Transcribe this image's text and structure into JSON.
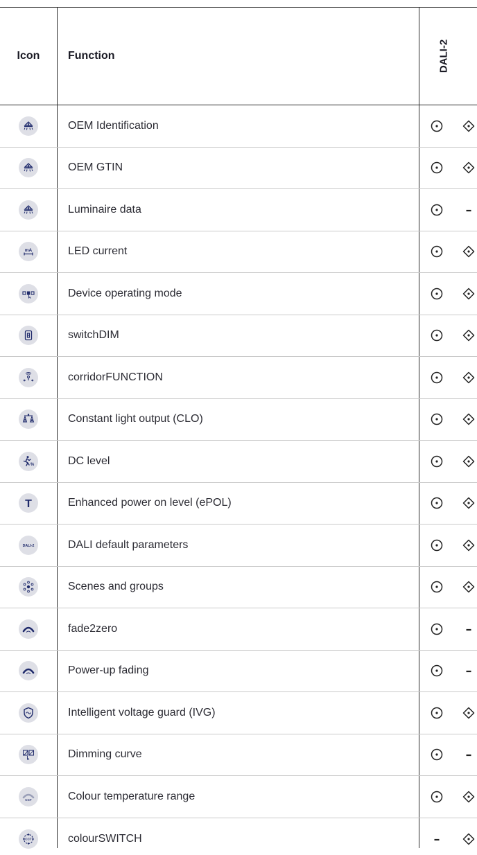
{
  "header": {
    "icon_label": "Icon",
    "function_label": "Function",
    "dali_label": "DALI-2"
  },
  "rows": [
    {
      "icon": "luminaire-info-icon",
      "function": "OEM Identification",
      "col1": "circle-dot",
      "col2": "diamond-dot"
    },
    {
      "icon": "luminaire-info-icon",
      "function": "OEM GTIN",
      "col1": "circle-dot",
      "col2": "diamond-dot"
    },
    {
      "icon": "luminaire-info-icon",
      "function": "Luminaire data",
      "col1": "circle-dot",
      "col2": "dash"
    },
    {
      "icon": "led-current-icon",
      "function": "LED current",
      "col1": "circle-dot",
      "col2": "diamond-dot"
    },
    {
      "icon": "operating-mode-icon",
      "function": "Device operating mode",
      "col1": "circle-dot",
      "col2": "diamond-dot"
    },
    {
      "icon": "switch-icon",
      "function": "switchDIM",
      "col1": "circle-dot",
      "col2": "diamond-dot"
    },
    {
      "icon": "corridor-sensor-icon",
      "function": "corridorFUNCTION",
      "col1": "circle-dot",
      "col2": "diamond-dot"
    },
    {
      "icon": "constant-light-icon",
      "function": "Constant light output (CLO)",
      "col1": "circle-dot",
      "col2": "diamond-dot"
    },
    {
      "icon": "dc-level-icon",
      "function": "DC level",
      "col1": "circle-dot",
      "col2": "diamond-dot"
    },
    {
      "icon": "power-on-level-icon",
      "function": "Enhanced power on level (ePOL)",
      "col1": "circle-dot",
      "col2": "diamond-dot"
    },
    {
      "icon": "dali-defaults-icon",
      "function": "DALI default parameters",
      "col1": "circle-dot",
      "col2": "diamond-dot"
    },
    {
      "icon": "scenes-groups-icon",
      "function": "Scenes and groups",
      "col1": "circle-dot",
      "col2": "diamond-dot"
    },
    {
      "icon": "fade-arc-icon",
      "function": "fade2zero",
      "col1": "circle-dot",
      "col2": "dash"
    },
    {
      "icon": "fade-arc-icon",
      "function": "Power-up fading",
      "col1": "circle-dot",
      "col2": "dash"
    },
    {
      "icon": "voltage-guard-icon",
      "function": "Intelligent voltage guard (IVG)",
      "col1": "circle-dot",
      "col2": "diamond-dot"
    },
    {
      "icon": "dimming-curve-icon",
      "function": "Dimming curve",
      "col1": "circle-dot",
      "col2": "dash"
    },
    {
      "icon": "cct-range-icon",
      "function": "Colour temperature range",
      "col1": "circle-dot",
      "col2": "diamond-dot"
    },
    {
      "icon": "cct-switch-icon",
      "function": "colourSWITCH",
      "col1": "dash",
      "col2": "diamond-dot"
    }
  ],
  "colors": {
    "icon_bg": "#dedfe6",
    "icon_fg": "#1f2a6b",
    "text": "#2b2b33",
    "mark": "#222222"
  },
  "icon_text": {
    "led_current": "mA",
    "dali": "DALI-2",
    "cct": "CCT",
    "power_on": "T",
    "dc_level": "%"
  }
}
